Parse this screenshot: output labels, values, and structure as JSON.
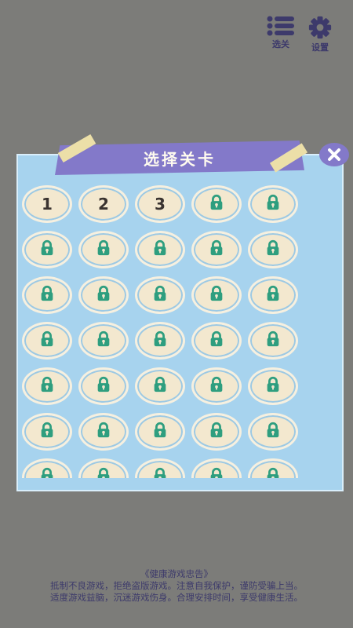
{
  "header": {
    "levels_label": "选关",
    "settings_label": "设置",
    "levels_icon": "list-icon",
    "settings_icon": "gear-icon"
  },
  "panel": {
    "title": "选择关卡",
    "close_icon": "close-icon"
  },
  "levels": [
    {
      "label": "1",
      "locked": false
    },
    {
      "label": "2",
      "locked": false
    },
    {
      "label": "3",
      "locked": false
    },
    {
      "label": "",
      "locked": true
    },
    {
      "label": "",
      "locked": true
    },
    {
      "label": "",
      "locked": true
    },
    {
      "label": "",
      "locked": true
    },
    {
      "label": "",
      "locked": true
    },
    {
      "label": "",
      "locked": true
    },
    {
      "label": "",
      "locked": true
    },
    {
      "label": "",
      "locked": true
    },
    {
      "label": "",
      "locked": true
    },
    {
      "label": "",
      "locked": true
    },
    {
      "label": "",
      "locked": true
    },
    {
      "label": "",
      "locked": true
    },
    {
      "label": "",
      "locked": true
    },
    {
      "label": "",
      "locked": true
    },
    {
      "label": "",
      "locked": true
    },
    {
      "label": "",
      "locked": true
    },
    {
      "label": "",
      "locked": true
    },
    {
      "label": "",
      "locked": true
    },
    {
      "label": "",
      "locked": true
    },
    {
      "label": "",
      "locked": true
    },
    {
      "label": "",
      "locked": true
    },
    {
      "label": "",
      "locked": true
    },
    {
      "label": "",
      "locked": true
    },
    {
      "label": "",
      "locked": true
    },
    {
      "label": "",
      "locked": true
    },
    {
      "label": "",
      "locked": true
    },
    {
      "label": "",
      "locked": true
    },
    {
      "label": "",
      "locked": true
    },
    {
      "label": "",
      "locked": true
    },
    {
      "label": "",
      "locked": true
    },
    {
      "label": "",
      "locked": true
    },
    {
      "label": "",
      "locked": true
    }
  ],
  "notice": {
    "title": "《健康游戏忠告》",
    "line1": "抵制不良游戏，拒绝盗版游戏。注意自我保护，谨防受骗上当。",
    "line2": "适度游戏益脑，沉迷游戏伤身。合理安排时间，享受健康生活。"
  },
  "colors": {
    "background": "#7c7c79",
    "panel": "#a7d3ee",
    "banner": "#8379c9",
    "lock": "#2e9e7f",
    "button": "#f3e8cf",
    "header_text": "#3d3a6b"
  }
}
